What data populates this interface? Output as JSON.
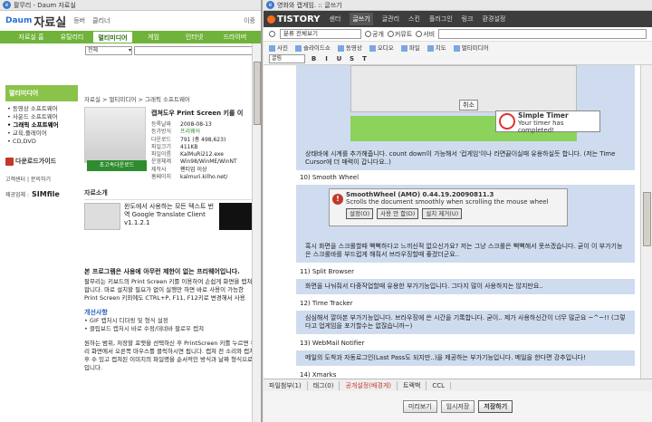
{
  "left": {
    "window_title": "팔무리 - Daum 자료실",
    "logo_daum": "Daum",
    "logo_text": "자료실",
    "top_links": [
      "등버",
      "클리너"
    ],
    "right_link": "이중",
    "categories": [
      "자료실 홈",
      "유틸리티",
      "멀티미디어",
      "게임",
      "인터넷",
      "드라이버"
    ],
    "active_category": "멀티미디어",
    "search_select": "전체",
    "left_box_title": "멀티미디어",
    "left_menu": [
      "동영상 소프트웨어",
      "사운드 소프트웨어",
      "그래픽 소프트웨어",
      "교육,플레이어",
      "CD,DVD"
    ],
    "left_menu_current": "그래픽 소프트웨어",
    "download_guide": "다운로드가이드",
    "small_links": "고객센터 | 문의하기",
    "sponsor_label": "제공업체 :",
    "sponsor_name": "SIMfile",
    "breadcrumb": "자료실 > 멀티미디어 > 그래픽 소프트웨어",
    "product_name": "캡쳐도우 Print Screen 키를 이",
    "download_button": "초고속다운로드",
    "product_info": [
      {
        "k": "등록날짜",
        "v": "2008-08-13"
      },
      {
        "k": "등가방식",
        "v": "프리웨어"
      },
      {
        "k": "다운로드",
        "v": "791 (총 498,623)"
      },
      {
        "k": "파일크기",
        "v": "411KB"
      },
      {
        "k": "파일이름",
        "v": "KalMuRi212.exe"
      },
      {
        "k": "운영체제",
        "v": "Win98/WinME/WinNT"
      },
      {
        "k": "제작사",
        "v": "팬티업 이상"
      },
      {
        "k": "홈페이지",
        "v": "kalmuri.kilho.net/"
      }
    ],
    "intro_title": "자료소개",
    "related_title": "윈도에서 사용하는 모든 텍스트 번역 Google Translate Client v1.1.2.1",
    "para_bold": "본 프로그램은 사용에 아무런 제한이 없는 프리웨어입니다.",
    "para": "팔무리는 키보드의 Print Screen 키를 이용하여 손쉽게 화면을 캡쳐합니다. 마로 설치할 필요가 없이 실행만 하면 바로 사용이 가능한 Print Screen 키외에도 CTRL+P, F11, F12키로 변경해서 사용",
    "improve_title": "개선사항",
    "improve_items": [
      "GIF 캡처시 디더링 및 형식 설정",
      "클립보드 캡처시 바로 수정/데네바 팔로우 캡쳐"
    ],
    "para2": "원하는 범위, 저장할 포맷을 선택하신 후 PrintScreen 키를 누르면 우리 화면에서 오른쪽 마우스를 클릭하시면 됩니다. 캡쳐 전 소리와 캡쳐 후 수 있고 캡쳐된 이미지의 파일명을 순서적인 방식과 날짜 형식으로 입니다."
  },
  "right": {
    "window_title": "영화와 캡게임. :: 글쓰기",
    "nav_logo": "TISTORY",
    "nav_items": [
      "센터",
      "글쓰기",
      "글관리",
      "스킨",
      "플러그인",
      "링크",
      "환경설정"
    ],
    "nav_active": "글쓰기",
    "category_select": "분류 전체보기",
    "radios": [
      "공개",
      "커뮤트",
      "서비"
    ],
    "insert_items": [
      "사진",
      "슬라이드쇼",
      "동영상",
      "오디오",
      "파일",
      "지도",
      "멀티미디어"
    ],
    "font_select": "굴림",
    "format_buttons": [
      "B",
      "I",
      "U",
      "S",
      "T"
    ],
    "timer_cancel": "취소",
    "timer_title": "Simple Timer",
    "timer_msg": "Your timer has completed!",
    "timer_caption": "상태바에 시계를 추가해줍니다. count down이 가능해서 '컵게임'이나 라면끓이실때 유용하실듯 합니다. (저는 Time Cursor에 더 매력이 갑니다요..)",
    "h10": "10) Smooth Wheel",
    "sw_title": "SmoothWheel (AMO)  0.44.19.20090811.3",
    "sw_msg": "Scrolls the document smoothly when scrolling the mouse wheel",
    "sw_buttons": [
      "설정(O)",
      "사용 안 함(D)",
      "설치 제거(U)"
    ],
    "sw_caption": "혹시 화면을 스크롤할때 뻑뻑하다고 느끼신적 없으신가요? 저는 그냥 스크롤은 뻑뻑해서 못쓰겠습니다. 굳이 이 부가기능은 스크롤바를 부드럽게 해줘서 브라우징할때 좋겠더군요..",
    "h11": "11) Split Browser",
    "c11": "화면을 나눠줘서 다중작업할때 유용한 부가기능입니다. 그다지 많이 사용하지는 않지만요..",
    "h12": "12) Time Tracker",
    "c12": "심심해서 깔아본 부가기능입니다. 브라우징에 쓴 시간을 기록합니다. 굳이.. 제가 사용하신간이 너무 많군요 ~^~!! (그렇다고 업게임을 포기할수는 없잖습니까~)",
    "h13": "13) WebMail Notifier",
    "c13": "메일의 도착과 자동로그인(Last Pass도 되지만..)을 제공하는 부가기능입니다. 메일을 한다면 강추입니다!",
    "h14": "14) Xmarks",
    "tabs": [
      "파일첨부(1)",
      "태그(0)",
      "공개설정(배경게)",
      "트랙백",
      "CCL"
    ],
    "buttons": [
      "미리보기",
      "임시저장",
      "저장하기"
    ]
  }
}
